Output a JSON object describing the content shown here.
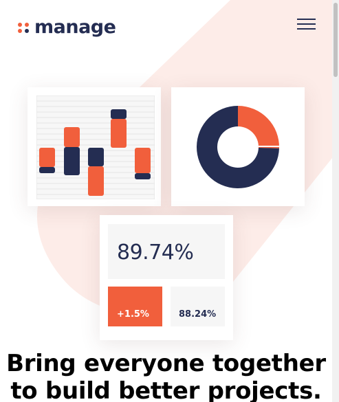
{
  "brand": {
    "name": "manage",
    "accent_color": "#f15f3c",
    "dark_color": "#242d52",
    "soft_bg_color": "#fdece8",
    "logo_dot_colors": [
      "#f15f3c",
      "#f15f3c",
      "#f15f3c",
      "#242d52"
    ]
  },
  "header": {
    "menu_icon": "hamburger-menu-icon"
  },
  "illustration": {
    "bar_chart": {
      "type": "bar",
      "bars": [
        {
          "top_color": "orange",
          "segments": [
            {
              "color": "orange",
              "size": 28
            },
            {
              "color": "navy",
              "size": 9
            }
          ]
        },
        {
          "top_color": "orange",
          "segments": [
            {
              "color": "orange",
              "size": 29
            },
            {
              "color": "navy",
              "size": 41
            }
          ]
        },
        {
          "top_color": "navy",
          "segments": [
            {
              "color": "navy",
              "size": 27
            },
            {
              "color": "orange",
              "size": 43
            }
          ]
        },
        {
          "top_color": "navy",
          "segments": [
            {
              "color": "navy",
              "size": 14
            },
            {
              "color": "orange",
              "size": 42
            }
          ]
        },
        {
          "top_color": "orange",
          "segments": [
            {
              "color": "orange",
              "size": 37
            },
            {
              "color": "navy",
              "size": 9
            }
          ]
        }
      ]
    },
    "donut_chart": {
      "type": "pie",
      "slices": [
        {
          "color": "orange",
          "share": 0.255
        },
        {
          "color": "navy",
          "share": 0.745
        }
      ]
    },
    "stats": {
      "main_value": "89.74%",
      "change_value": "+1.5%",
      "secondary_value": "88.24%"
    }
  },
  "hero": {
    "headline_line1": "Bring everyone together",
    "headline_line2": "to build better projects."
  }
}
